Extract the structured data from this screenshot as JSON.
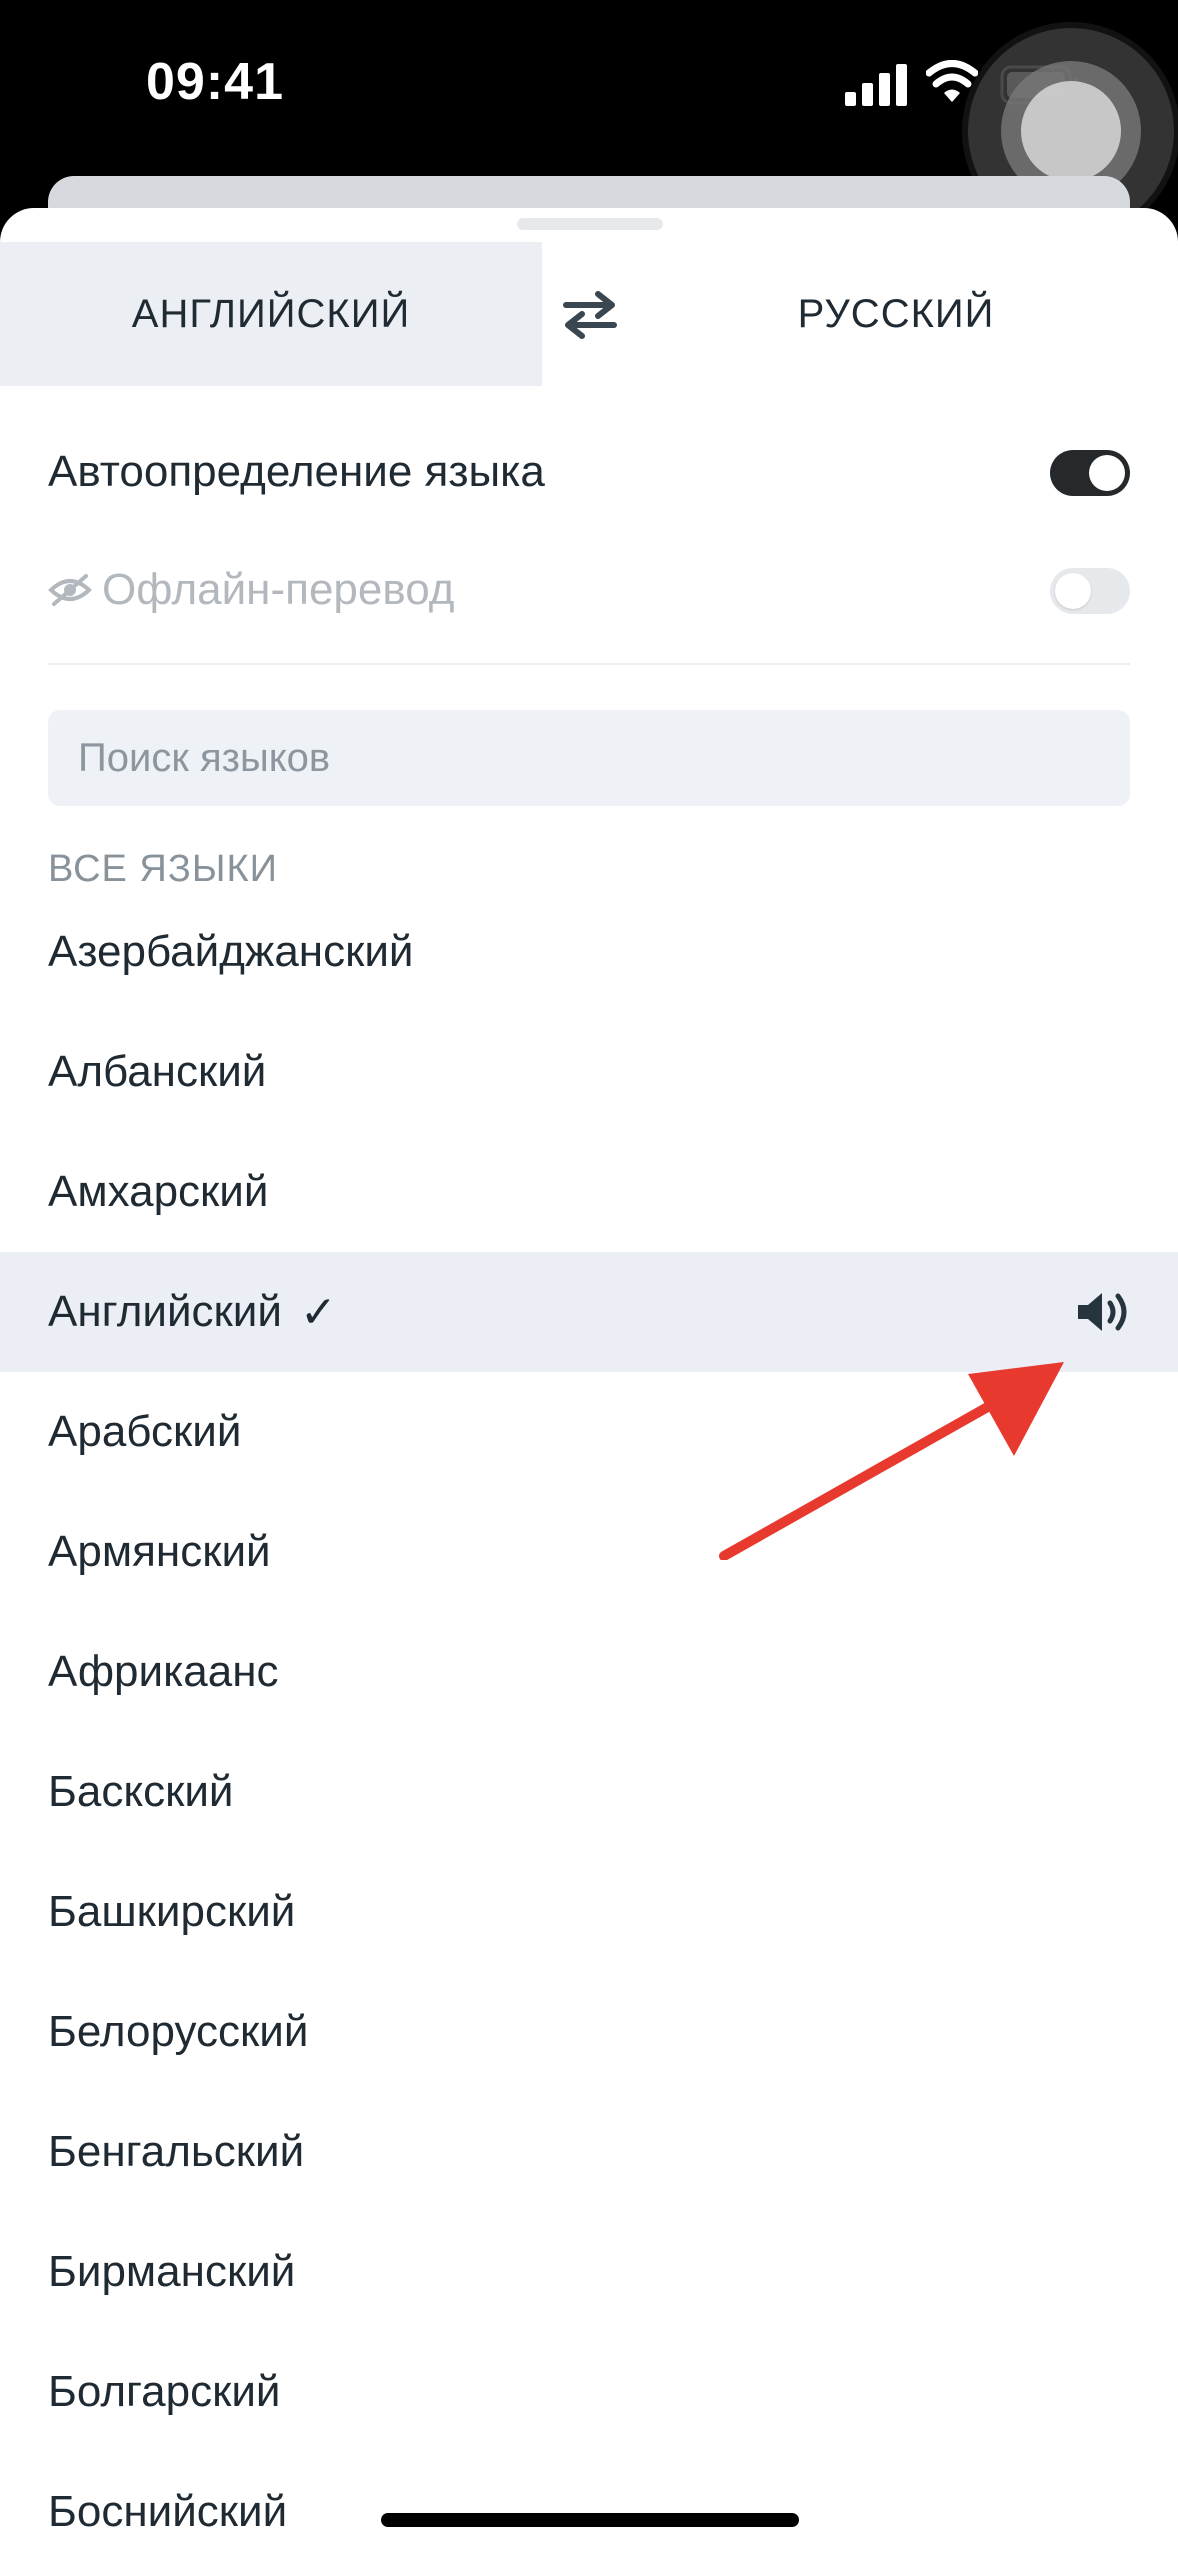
{
  "status_bar": {
    "time": "09:41"
  },
  "language_bar": {
    "source_language": "АНГЛИЙСКИЙ",
    "target_language": "РУССКИЙ",
    "swap_icon": "swap-arrows-icon"
  },
  "settings": {
    "autodetect": {
      "label": "Автоопределение языка",
      "enabled": true
    },
    "offline": {
      "label": "Офлайн-перевод",
      "enabled": false,
      "icon": "offline-eye-crossed-icon"
    }
  },
  "search": {
    "placeholder": "Поиск языков"
  },
  "list": {
    "section_header": "ВСЕ ЯЗЫКИ",
    "items": [
      {
        "label": "Азербайджанский"
      },
      {
        "label": "Албанский"
      },
      {
        "label": "Амхарский"
      },
      {
        "label": "Английский",
        "selected": true,
        "check": "✓"
      },
      {
        "label": "Арабский"
      },
      {
        "label": "Армянский"
      },
      {
        "label": "Африкаанс"
      },
      {
        "label": "Баскский"
      },
      {
        "label": "Башкирский"
      },
      {
        "label": "Белорусский"
      },
      {
        "label": "Бенгальский"
      },
      {
        "label": "Бирманский"
      },
      {
        "label": "Болгарский"
      },
      {
        "label": "Боснийский"
      }
    ]
  },
  "colors": {
    "accent_dark": "#26292c",
    "selected_row_bg": "#ebeff5",
    "annotation_arrow": "#e8392f"
  }
}
